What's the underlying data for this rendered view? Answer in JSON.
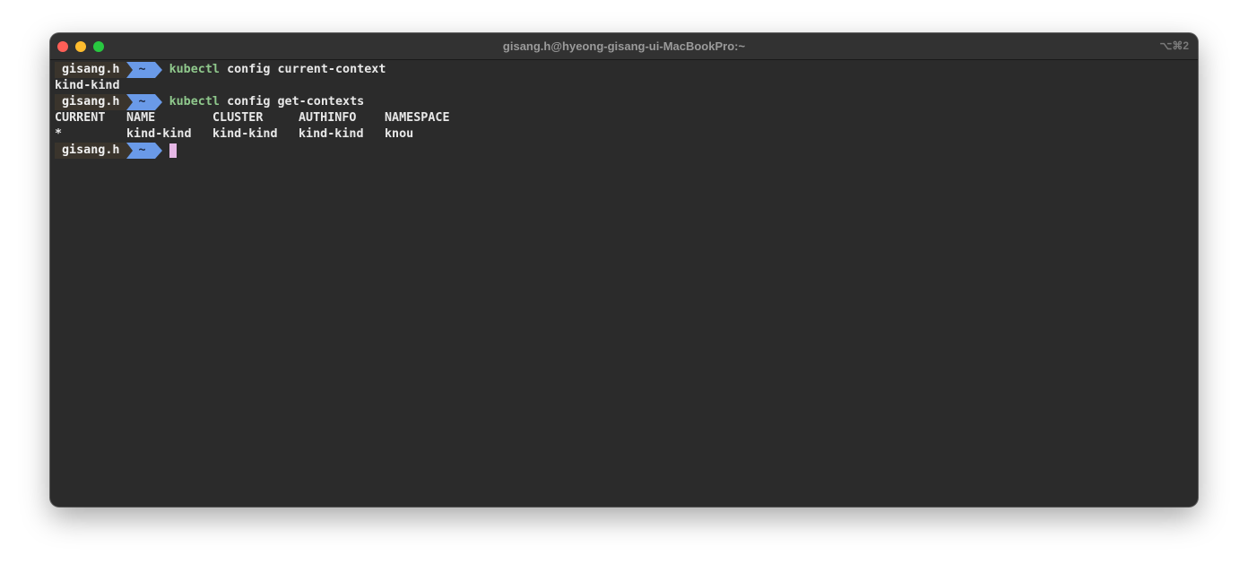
{
  "window": {
    "title": "gisang.h@hyeong-gisang-ui-MacBookPro:~",
    "shortcut": "⌥⌘2"
  },
  "prompt": {
    "user": "gisang.h",
    "dir": "~"
  },
  "lines": {
    "cmd1": {
      "name": "kubectl",
      "args": "config current-context"
    },
    "out1": "kind-kind",
    "cmd2": {
      "name": "kubectl",
      "args": "config get-contexts"
    },
    "table": {
      "headers": [
        "CURRENT",
        "NAME",
        "CLUSTER",
        "AUTHINFO",
        "NAMESPACE"
      ],
      "row": [
        "*",
        "kind-kind",
        "kind-kind",
        "kind-kind",
        "knou"
      ]
    }
  },
  "colors": {
    "background": "#2b2b2b",
    "prompt_user_bg": "#3a342c",
    "prompt_dir_bg": "#6a9ae8",
    "command_green": "#8fc88c",
    "cursor": "#e6b8e6"
  }
}
